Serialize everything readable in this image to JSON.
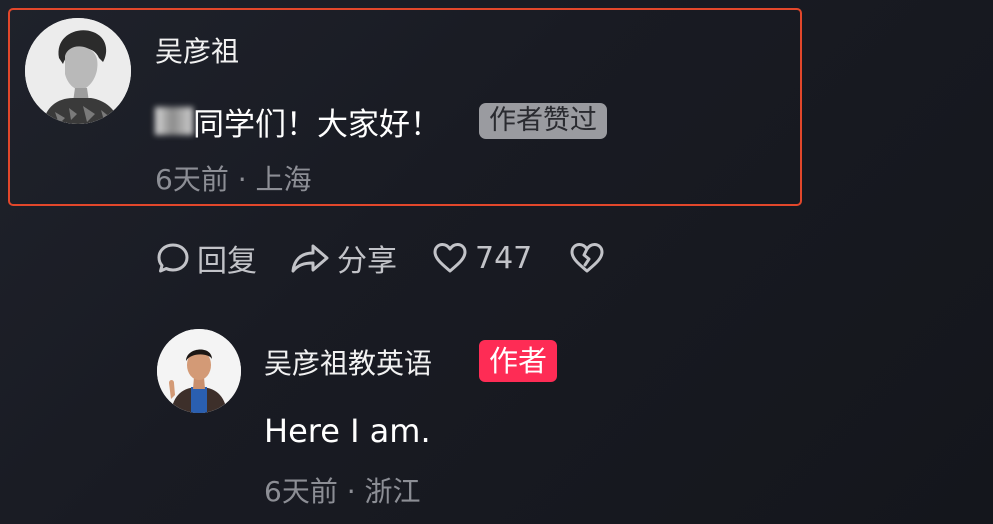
{
  "comment": {
    "username": "吴彦祖",
    "text": "同学们！大家好！",
    "liked_badge": "作者赞过",
    "time": "6天前",
    "separator": " · ",
    "location": "上海"
  },
  "actions": {
    "reply_label": "回复",
    "share_label": "分享",
    "like_count": "747",
    "reply_icon": "speech-bubble-icon",
    "share_icon": "share-arrow-icon",
    "like_icon": "heart-outline-icon",
    "dislike_icon": "broken-heart-icon"
  },
  "reply": {
    "username": "吴彦祖教英语",
    "author_badge": "作者",
    "text": "Here I am.",
    "time": "6天前",
    "separator": " · ",
    "location": "浙江"
  },
  "colors": {
    "highlight_border": "#e2472b",
    "author_badge_bg": "#fe2c55",
    "liked_badge_bg": "#9a9ba0",
    "meta_text": "#8c8e95"
  }
}
